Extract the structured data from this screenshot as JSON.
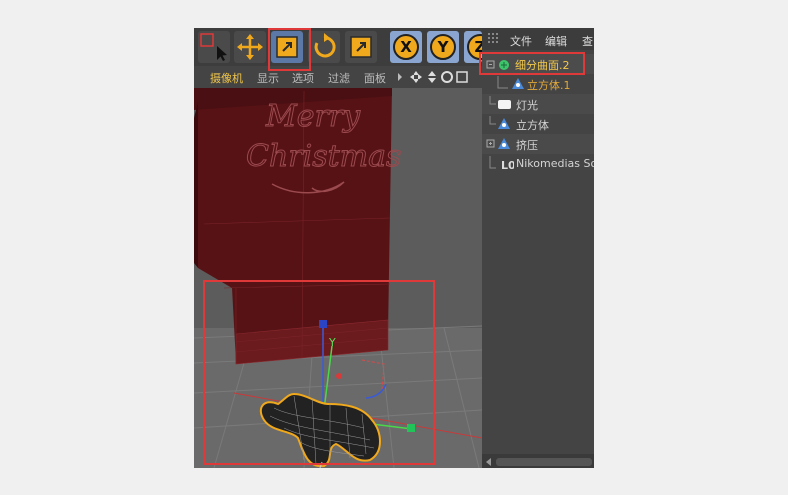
{
  "toolbar": {
    "buttons": [
      {
        "name": "live-selection",
        "icon": "select-arrow-icon"
      },
      {
        "name": "move",
        "icon": "move-icon"
      },
      {
        "name": "scale",
        "icon": "scale-icon",
        "active": true
      },
      {
        "name": "rotate",
        "icon": "rotate-icon"
      },
      {
        "name": "recent-tool",
        "icon": "scale-alt-icon"
      }
    ],
    "axes": [
      "X",
      "Y",
      "Z"
    ]
  },
  "viewport_menu": {
    "items": [
      "摄像机",
      "显示",
      "选项",
      "过滤",
      "面板"
    ],
    "active_item": "摄像机"
  },
  "object_manager": {
    "menu": [
      "文件",
      "编辑",
      "查"
    ],
    "objects": [
      {
        "label": "细分曲面.2",
        "icon": "subdivision-icon",
        "selected": true
      },
      {
        "label": "立方体.1",
        "icon": "cube-icon",
        "child": true
      },
      {
        "label": "灯光",
        "icon": "light-icon"
      },
      {
        "label": "立方体",
        "icon": "cube-icon"
      },
      {
        "label": "挤压",
        "icon": "extrude-icon"
      },
      {
        "label": "Nikomedias So",
        "icon": "null-icon"
      }
    ]
  },
  "scene": {
    "card_text": [
      "Merry",
      "Christmas"
    ]
  },
  "colors": {
    "highlight": "#e0393a",
    "selected_text": "#f2c94c",
    "card": "#5e1518",
    "accent_orange": "#f0a81c"
  }
}
